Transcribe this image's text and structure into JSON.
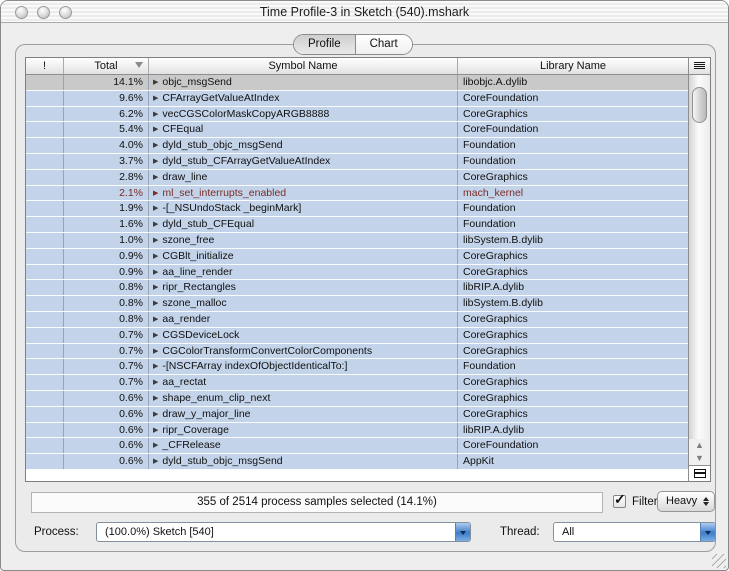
{
  "window": {
    "title": "Time Profile-3 in Sketch (540).mshark"
  },
  "tabs": [
    {
      "label": "Profile",
      "selected": true
    },
    {
      "label": "Chart",
      "selected": false
    }
  ],
  "table": {
    "columns": [
      "!",
      "Total",
      "Symbol Name",
      "Library Name"
    ],
    "sort": {
      "column": "Total",
      "direction": "desc"
    },
    "rows": [
      {
        "total": "14.1%",
        "symbol": "objc_msgSend",
        "library": "libobjc.A.dylib",
        "selected": true,
        "kernel": false
      },
      {
        "total": "9.6%",
        "symbol": "CFArrayGetValueAtIndex",
        "library": "CoreFoundation",
        "selected": false,
        "kernel": false
      },
      {
        "total": "6.2%",
        "symbol": "vecCGSColorMaskCopyARGB8888",
        "library": "CoreGraphics",
        "selected": false,
        "kernel": false
      },
      {
        "total": "5.4%",
        "symbol": "CFEqual",
        "library": "CoreFoundation",
        "selected": false,
        "kernel": false
      },
      {
        "total": "4.0%",
        "symbol": "dyld_stub_objc_msgSend",
        "library": "Foundation",
        "selected": false,
        "kernel": false
      },
      {
        "total": "3.7%",
        "symbol": "dyld_stub_CFArrayGetValueAtIndex",
        "library": "Foundation",
        "selected": false,
        "kernel": false
      },
      {
        "total": "2.8%",
        "symbol": "draw_line",
        "library": "CoreGraphics",
        "selected": false,
        "kernel": false
      },
      {
        "total": "2.1%",
        "symbol": "ml_set_interrupts_enabled",
        "library": "mach_kernel",
        "selected": false,
        "kernel": true
      },
      {
        "total": "1.9%",
        "symbol": "-[_NSUndoStack _beginMark]",
        "library": "Foundation",
        "selected": false,
        "kernel": false
      },
      {
        "total": "1.6%",
        "symbol": "dyld_stub_CFEqual",
        "library": "Foundation",
        "selected": false,
        "kernel": false
      },
      {
        "total": "1.0%",
        "symbol": "szone_free",
        "library": "libSystem.B.dylib",
        "selected": false,
        "kernel": false
      },
      {
        "total": "0.9%",
        "symbol": "CGBlt_initialize",
        "library": "CoreGraphics",
        "selected": false,
        "kernel": false
      },
      {
        "total": "0.9%",
        "symbol": "aa_line_render",
        "library": "CoreGraphics",
        "selected": false,
        "kernel": false
      },
      {
        "total": "0.8%",
        "symbol": "ripr_Rectangles",
        "library": "libRIP.A.dylib",
        "selected": false,
        "kernel": false
      },
      {
        "total": "0.8%",
        "symbol": "szone_malloc",
        "library": "libSystem.B.dylib",
        "selected": false,
        "kernel": false
      },
      {
        "total": "0.8%",
        "symbol": "aa_render",
        "library": "CoreGraphics",
        "selected": false,
        "kernel": false
      },
      {
        "total": "0.7%",
        "symbol": "CGSDeviceLock",
        "library": "CoreGraphics",
        "selected": false,
        "kernel": false
      },
      {
        "total": "0.7%",
        "symbol": "CGColorTransformConvertColorComponents",
        "library": "CoreGraphics",
        "selected": false,
        "kernel": false
      },
      {
        "total": "0.7%",
        "symbol": "-[NSCFArray indexOfObjectIdenticalTo:]",
        "library": "Foundation",
        "selected": false,
        "kernel": false
      },
      {
        "total": "0.7%",
        "symbol": "aa_rectat",
        "library": "CoreGraphics",
        "selected": false,
        "kernel": false
      },
      {
        "total": "0.6%",
        "symbol": "shape_enum_clip_next",
        "library": "CoreGraphics",
        "selected": false,
        "kernel": false
      },
      {
        "total": "0.6%",
        "symbol": "draw_y_major_line",
        "library": "CoreGraphics",
        "selected": false,
        "kernel": false
      },
      {
        "total": "0.6%",
        "symbol": "ripr_Coverage",
        "library": "libRIP.A.dylib",
        "selected": false,
        "kernel": false
      },
      {
        "total": "0.6%",
        "symbol": "_CFRelease",
        "library": "CoreFoundation",
        "selected": false,
        "kernel": false
      },
      {
        "total": "0.6%",
        "symbol": "dyld_stub_objc_msgSend",
        "library": "AppKit",
        "selected": false,
        "kernel": false
      }
    ]
  },
  "status": {
    "summary": "355 of 2514 process samples selected (14.1%)",
    "filter_label": "Filter",
    "filter_checked": true,
    "check_glyph": "✓",
    "view_mode": "Heavy"
  },
  "footer": {
    "process_label": "Process:",
    "process_value": "(100.0%) Sketch [540]",
    "thread_label": "Thread:",
    "thread_value": "All"
  },
  "colors": {
    "row_blue": "#c3d3e9",
    "row_selected": "#c9c9c9",
    "kernel_text": "#7b2d26",
    "popup_blue": "#3f7cc8",
    "popup_blue_light": "#aecdf0"
  }
}
